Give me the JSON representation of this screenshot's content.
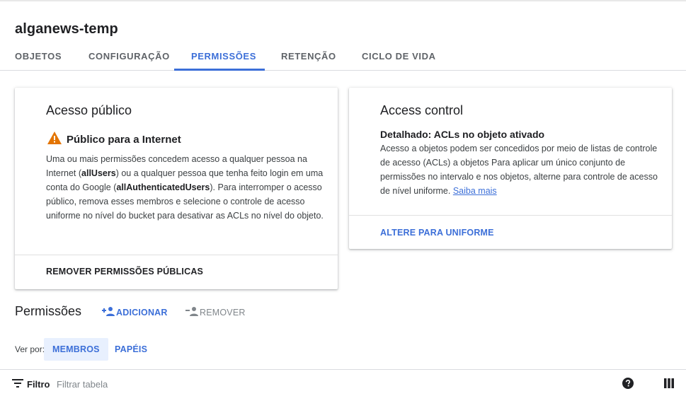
{
  "title": "alganews-temp",
  "tabs": [
    {
      "label": "OBJETOS"
    },
    {
      "label": "CONFIGURAÇÃO"
    },
    {
      "label": "PERMISSÕES"
    },
    {
      "label": "RETENÇÃO"
    },
    {
      "label": "CICLO DE VIDA"
    }
  ],
  "active_tab": "PERMISSÕES",
  "public_access": {
    "title": "Acesso público",
    "warning_title": "Público para a Internet",
    "body_1": "Uma ou mais permissões concedem acesso a qualquer pessoa na Internet (",
    "bold_1": "allUsers",
    "body_2": ") ou a qualquer pessoa que tenha feito login em uma conta do Google (",
    "bold_2": "allAuthenticatedUsers",
    "body_3": "). Para interromper o acesso público, remova esses membros e selecione o controle de acesso uniforme no nível do bucket para desativar as ACLs no nível do objeto.",
    "action": "REMOVER PERMISSÕES PÚBLICAS"
  },
  "access_control": {
    "title": "Access control",
    "subtitle": "Detalhado: ACLs no objeto ativado",
    "body": "Acesso a objetos podem ser concedidos por meio de listas de controle de acesso (ACLs) a objetos Para aplicar um único conjunto de permissões no intervalo e nos objetos, alterne para controle de acesso de nível uniforme.",
    "link": "Saiba mais",
    "action": "ALTERE PARA UNIFORME"
  },
  "permissions": {
    "title": "Permissões",
    "add_label": "ADICIONAR",
    "remove_label": "REMOVER"
  },
  "view_by": {
    "label": "Ver por:",
    "options": [
      {
        "label": "MEMBROS"
      },
      {
        "label": "PAPÉIS"
      }
    ],
    "selected": "MEMBROS"
  },
  "filter": {
    "label": "Filtro",
    "placeholder": "Filtrar tabela"
  },
  "colors": {
    "accent": "#3c6fd8",
    "warning": "#e37400",
    "disabled": "#80868b",
    "chip_bg": "#e8f0fe"
  },
  "icons": {
    "warning": "warning-icon",
    "add_person": "add-person-icon",
    "remove_person": "remove-person-icon",
    "filter": "filter-icon",
    "help": "help-icon",
    "columns": "columns-icon"
  }
}
